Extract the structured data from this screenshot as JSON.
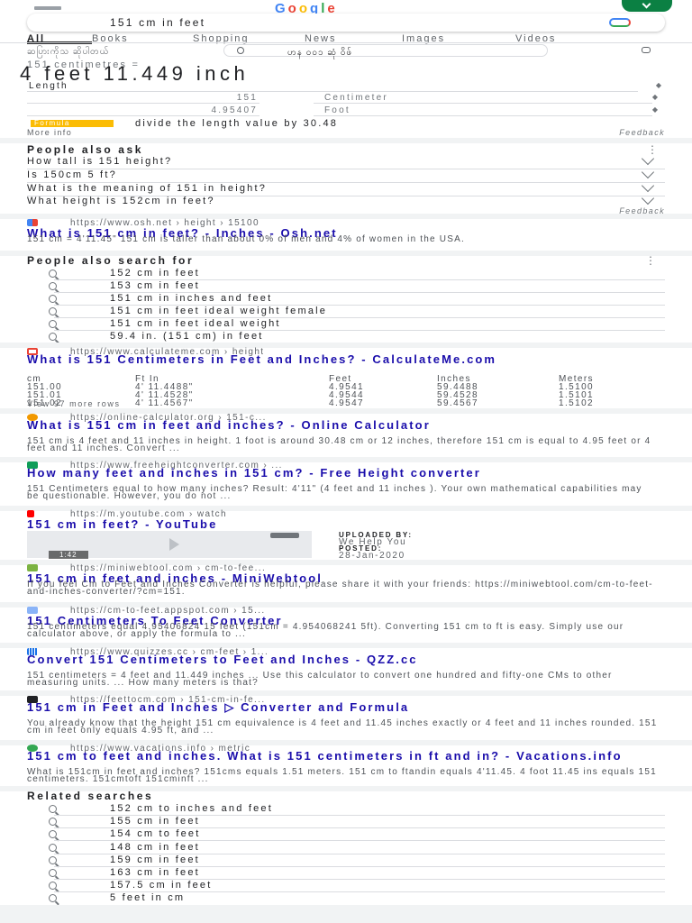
{
  "header": {
    "query": "151 cm in feet",
    "logo_text": "Google",
    "avatar_color": "#0b8043"
  },
  "tabs": [
    "All",
    "Books",
    "Shopping",
    "News",
    "Images",
    "Videos"
  ],
  "subsearch": {
    "left_text": "ဆပြားကိုသ ဆိုပါတယ်",
    "right_text": "ဟန ဝဝ၁ ဆုံ ဝိဖ်"
  },
  "converter": {
    "overline": "151 centimetres =",
    "result": "4 feet 11.449 inch",
    "unit_type": "Length",
    "input_value": "151",
    "input_unit": "Centimeter",
    "output_value": "4.95407",
    "output_unit": "Foot",
    "formula_badge": "Formula",
    "formula_text": "divide the length value by 30.48",
    "more_info": "More info",
    "feedback": "Feedback"
  },
  "paa": {
    "title": "People also ask",
    "questions": [
      "How tall is 151 height?",
      "Is 150cm 5 ft?",
      "What is the meaning of 151 in height?",
      "What height is 152cm in feet?"
    ],
    "feedback": "Feedback"
  },
  "result_osh": {
    "url": "https://www.osh.net › height › 15100",
    "title": "What is 151 cm in feet? - Inches - Osh.net",
    "snippet": "151 cm = 4'11.45\" 151 cm is taller than about 0% of men and 4% of women in the USA."
  },
  "pasf": {
    "title": "People also search for",
    "items": [
      "152 cm in feet",
      "153 cm in feet",
      "151 cm in inches and feet",
      "151 cm in feet ideal weight female",
      "151 cm in feet ideal weight",
      "59.4 in. (151 cm) in feet"
    ]
  },
  "result_calcme": {
    "url": "https://www.calculateme.com › height",
    "title": "What is 151 Centimeters in Feet and Inches? - CalculateMe.com",
    "table_headers": [
      "cm",
      "Ft In",
      "Feet",
      "Inches",
      "Meters"
    ],
    "table_rows": [
      [
        "151.00",
        "4' 11.4488\"",
        "4.9541",
        "59.4488",
        "1.5100"
      ],
      [
        "151.01",
        "4' 11.4528\"",
        "4.9544",
        "59.4528",
        "1.5101"
      ],
      [
        "151.02",
        "4' 11.4567\"",
        "4.9547",
        "59.4567",
        "1.5102"
      ]
    ],
    "more_rows": "View 97 more rows"
  },
  "result_online": {
    "url": "https://online-calculator.org › 151-c...",
    "title": "What is 151 cm in feet and inches? - Online Calculator",
    "snippet": "151 cm is 4 feet and 11 inches in height. 1 foot is around 30.48 cm or 12 inches, therefore 151 cm is equal to 4.95 feet or 4 feet and 11 inches. Convert ..."
  },
  "result_freeheight": {
    "url": "https://www.freeheightconverter.com › ...",
    "title": "How many feet and inches in 151 cm? - Free Height converter",
    "snippet": "151 Centimeters equal to how many inches? Result: 4'11\" (4 feet and 11 inches ). Your own mathematical capabilities may be questionable. However, you do not ..."
  },
  "result_youtube": {
    "url": "https://m.youtube.com › watch",
    "title": "151 cm in feet? - YouTube",
    "duration": "1:42",
    "uploaded_label": "UPLOADED BY:",
    "uploader": "We Help You",
    "posted_label": "POSTED:",
    "posted_date": "28-Jan-2020"
  },
  "result_miniweb": {
    "url": "https://miniwebtool.com › cm-to-fee...",
    "title": "151 cm in feet and inches - MiniWebtool",
    "snippet": "If you feel Cm to Feet and Inches Converter is helpful, please share it with your friends: https://miniwebtool.com/cm-to-feet-and-inches-converter/?cm=151."
  },
  "result_appspot": {
    "url": "https://cm-to-feet.appspot.com › 15...",
    "title": "151 Centimeters To Feet Converter",
    "snippet": "151 centimeters equal 4.95406824 15 feet (151cm = 4.954068241 5ft). Converting 151 cm to ft is easy. Simply use our calculator above, or apply the formula to ..."
  },
  "result_quizzes": {
    "url": "https://www.quizzes.cc › cm-feet › 1...",
    "title": "Convert 151 Centimeters to Feet and Inches - QZZ.cc",
    "snippet": "151 centimeters = 4 feet and 11.449 inches ... Use this calculator to convert one hundred and fifty-one CMs to other measuring units. ... How many meters is that?"
  },
  "result_feettocm": {
    "url": "https://feettocm.com › 151-cm-in-fe...",
    "title": "151 cm in Feet and Inches ▷ Converter and Formula",
    "snippet": "You already know that the height 151 cm equivalence is 4 feet and 11.45 inches exactly or 4 feet and 11 inches rounded. 151 cm in feet only equals 4.95 ft, and ..."
  },
  "result_vacations": {
    "url": "https://www.vacations.info › metric",
    "title": "151 cm to feet and inches. What is 151 centimeters in ft and in? - Vacations.info",
    "snippet": "What is 151cm in feet and inches? 151cms equals 1.51 meters. 151 cm to ftandin equals 4'11.45. 4 foot 11.45 ins equals 151 centimeters. 151cmtoft 151cminft ..."
  },
  "related": {
    "title": "Related searches",
    "items": [
      "152 cm to inches and feet",
      "155 cm in feet",
      "154 cm to feet",
      "148 cm in feet",
      "159 cm in feet",
      "163 cm in feet",
      "157.5 cm in feet",
      "5 feet in cm"
    ]
  },
  "colors": {
    "link": "#1a0dab",
    "url": "#5f6368",
    "formula_badge": "#fbbc04"
  }
}
